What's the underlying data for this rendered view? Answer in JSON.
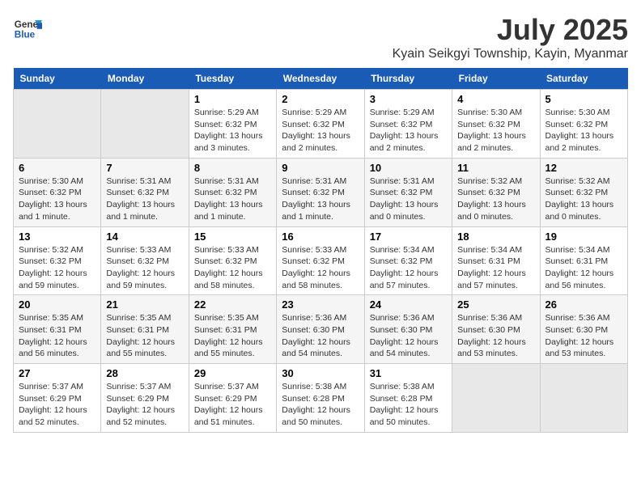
{
  "logo": {
    "general": "General",
    "blue": "Blue"
  },
  "title": "July 2025",
  "subtitle": "Kyain Seikgyi Township, Kayin, Myanmar",
  "days_header": [
    "Sunday",
    "Monday",
    "Tuesday",
    "Wednesday",
    "Thursday",
    "Friday",
    "Saturday"
  ],
  "weeks": [
    [
      {
        "day": "",
        "info": ""
      },
      {
        "day": "",
        "info": ""
      },
      {
        "day": "1",
        "info": "Sunrise: 5:29 AM\nSunset: 6:32 PM\nDaylight: 13 hours and 3 minutes."
      },
      {
        "day": "2",
        "info": "Sunrise: 5:29 AM\nSunset: 6:32 PM\nDaylight: 13 hours and 2 minutes."
      },
      {
        "day": "3",
        "info": "Sunrise: 5:29 AM\nSunset: 6:32 PM\nDaylight: 13 hours and 2 minutes."
      },
      {
        "day": "4",
        "info": "Sunrise: 5:30 AM\nSunset: 6:32 PM\nDaylight: 13 hours and 2 minutes."
      },
      {
        "day": "5",
        "info": "Sunrise: 5:30 AM\nSunset: 6:32 PM\nDaylight: 13 hours and 2 minutes."
      }
    ],
    [
      {
        "day": "6",
        "info": "Sunrise: 5:30 AM\nSunset: 6:32 PM\nDaylight: 13 hours and 1 minute."
      },
      {
        "day": "7",
        "info": "Sunrise: 5:31 AM\nSunset: 6:32 PM\nDaylight: 13 hours and 1 minute."
      },
      {
        "day": "8",
        "info": "Sunrise: 5:31 AM\nSunset: 6:32 PM\nDaylight: 13 hours and 1 minute."
      },
      {
        "day": "9",
        "info": "Sunrise: 5:31 AM\nSunset: 6:32 PM\nDaylight: 13 hours and 1 minute."
      },
      {
        "day": "10",
        "info": "Sunrise: 5:31 AM\nSunset: 6:32 PM\nDaylight: 13 hours and 0 minutes."
      },
      {
        "day": "11",
        "info": "Sunrise: 5:32 AM\nSunset: 6:32 PM\nDaylight: 13 hours and 0 minutes."
      },
      {
        "day": "12",
        "info": "Sunrise: 5:32 AM\nSunset: 6:32 PM\nDaylight: 13 hours and 0 minutes."
      }
    ],
    [
      {
        "day": "13",
        "info": "Sunrise: 5:32 AM\nSunset: 6:32 PM\nDaylight: 12 hours and 59 minutes."
      },
      {
        "day": "14",
        "info": "Sunrise: 5:33 AM\nSunset: 6:32 PM\nDaylight: 12 hours and 59 minutes."
      },
      {
        "day": "15",
        "info": "Sunrise: 5:33 AM\nSunset: 6:32 PM\nDaylight: 12 hours and 58 minutes."
      },
      {
        "day": "16",
        "info": "Sunrise: 5:33 AM\nSunset: 6:32 PM\nDaylight: 12 hours and 58 minutes."
      },
      {
        "day": "17",
        "info": "Sunrise: 5:34 AM\nSunset: 6:32 PM\nDaylight: 12 hours and 57 minutes."
      },
      {
        "day": "18",
        "info": "Sunrise: 5:34 AM\nSunset: 6:31 PM\nDaylight: 12 hours and 57 minutes."
      },
      {
        "day": "19",
        "info": "Sunrise: 5:34 AM\nSunset: 6:31 PM\nDaylight: 12 hours and 56 minutes."
      }
    ],
    [
      {
        "day": "20",
        "info": "Sunrise: 5:35 AM\nSunset: 6:31 PM\nDaylight: 12 hours and 56 minutes."
      },
      {
        "day": "21",
        "info": "Sunrise: 5:35 AM\nSunset: 6:31 PM\nDaylight: 12 hours and 55 minutes."
      },
      {
        "day": "22",
        "info": "Sunrise: 5:35 AM\nSunset: 6:31 PM\nDaylight: 12 hours and 55 minutes."
      },
      {
        "day": "23",
        "info": "Sunrise: 5:36 AM\nSunset: 6:30 PM\nDaylight: 12 hours and 54 minutes."
      },
      {
        "day": "24",
        "info": "Sunrise: 5:36 AM\nSunset: 6:30 PM\nDaylight: 12 hours and 54 minutes."
      },
      {
        "day": "25",
        "info": "Sunrise: 5:36 AM\nSunset: 6:30 PM\nDaylight: 12 hours and 53 minutes."
      },
      {
        "day": "26",
        "info": "Sunrise: 5:36 AM\nSunset: 6:30 PM\nDaylight: 12 hours and 53 minutes."
      }
    ],
    [
      {
        "day": "27",
        "info": "Sunrise: 5:37 AM\nSunset: 6:29 PM\nDaylight: 12 hours and 52 minutes."
      },
      {
        "day": "28",
        "info": "Sunrise: 5:37 AM\nSunset: 6:29 PM\nDaylight: 12 hours and 52 minutes."
      },
      {
        "day": "29",
        "info": "Sunrise: 5:37 AM\nSunset: 6:29 PM\nDaylight: 12 hours and 51 minutes."
      },
      {
        "day": "30",
        "info": "Sunrise: 5:38 AM\nSunset: 6:28 PM\nDaylight: 12 hours and 50 minutes."
      },
      {
        "day": "31",
        "info": "Sunrise: 5:38 AM\nSunset: 6:28 PM\nDaylight: 12 hours and 50 minutes."
      },
      {
        "day": "",
        "info": ""
      },
      {
        "day": "",
        "info": ""
      }
    ]
  ]
}
